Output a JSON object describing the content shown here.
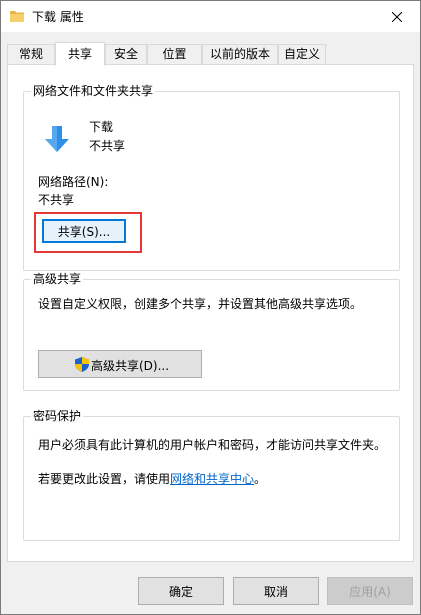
{
  "window": {
    "title": "下载 属性"
  },
  "tabs": [
    "常规",
    "共享",
    "安全",
    "位置",
    "以前的版本",
    "自定义"
  ],
  "sharing": {
    "group_title": "网络文件和文件夹共享",
    "folder_name": "下载",
    "share_status": "不共享",
    "network_path_label": "网络路径(N):",
    "network_path_value": "不共享",
    "share_button": "共享(S)..."
  },
  "advanced": {
    "group_title": "高级共享",
    "description": "设置自定义权限，创建多个共享，并设置其他高级共享选项。",
    "button": "高级共享(D)..."
  },
  "password": {
    "group_title": "密码保护",
    "description": "用户必须具有此计算机的用户帐户和密码，才能访问共享文件夹。",
    "change_prefix": "若要更改此设置，请使用",
    "change_link": "网络和共享中心",
    "change_suffix": "。"
  },
  "footer": {
    "ok": "确定",
    "cancel": "取消",
    "apply": "应用(A)"
  },
  "icons": {
    "title": "folder-icon",
    "folder": "download-arrow-icon",
    "shield": "uac-shield-icon",
    "close": "close-icon"
  },
  "colors": {
    "highlight": "#e53935",
    "link": "#0066cc",
    "arrow": "#2f8ee6"
  }
}
